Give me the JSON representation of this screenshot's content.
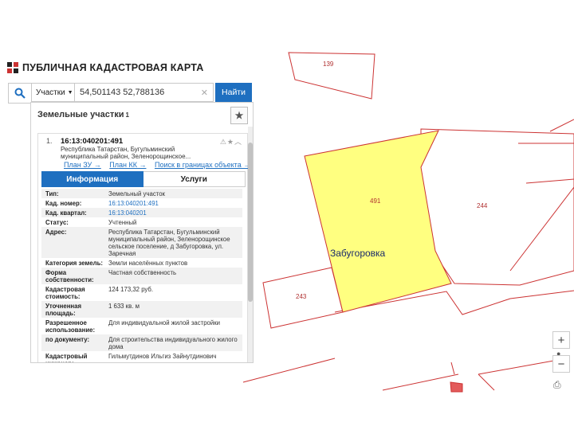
{
  "app": {
    "title": "ПУБЛИЧНАЯ КАДАСТРОВАЯ КАРТА"
  },
  "search": {
    "type_label": "Участки",
    "query": "54,501143 52,788136",
    "submit_label": "Найти"
  },
  "panel": {
    "header": "Земельные участки",
    "count": "1",
    "card": {
      "index": "1.",
      "cad_number": "16:13:040201:491",
      "address_short": "Республика Татарстан, Бугульминский муниципальный район, Зеленорощинское...",
      "links": [
        "План ЗУ →",
        "План КК →",
        "Поиск в границах объекта →"
      ],
      "tabs": [
        "Информация",
        "Услуги"
      ],
      "rows": [
        {
          "label": "Тип:",
          "value": "Земельный участок",
          "link": false
        },
        {
          "label": "Кад. номер:",
          "value": "16:13:040201:491",
          "link": true
        },
        {
          "label": "Кад. квартал:",
          "value": "16:13:040201",
          "link": true
        },
        {
          "label": "Статус:",
          "value": "Учтенный",
          "link": false
        },
        {
          "label": "Адрес:",
          "value": "Республика Татарстан, Бугульминский муниципальный район, Зеленорощинское сельское поселение, д Забугоровка, ул. Заречная",
          "link": false
        },
        {
          "label": "Категория земель:",
          "value": "Земли населённых пунктов",
          "link": false
        },
        {
          "label": "Форма собственности:",
          "value": "Частная собственность",
          "link": false
        },
        {
          "label": "Кадастровая стоимость:",
          "value": "124 173,32 руб.",
          "link": false
        },
        {
          "label": "Уточненная площадь:",
          "value": "1 633 кв. м",
          "link": false
        },
        {
          "label": "Разрешенное использование:",
          "value": "Для индивидуальной жилой застройки",
          "link": false
        },
        {
          "label": "по документу:",
          "value": "Для строительства индивидуального жилого дома",
          "link": false
        },
        {
          "label": "Кадастровый инженер:",
          "value": "Гильмутдинов Ильгиз Зайнутдинович",
          "link": false
        }
      ]
    }
  },
  "map": {
    "parcel_labels": [
      "139",
      "491",
      "244",
      "243"
    ],
    "village": "Забугоровка",
    "highlight_color": "#ffff80",
    "boundary_color": "#cc3333"
  },
  "controls": {
    "zoom_in": "+",
    "zoom_out": "−"
  }
}
